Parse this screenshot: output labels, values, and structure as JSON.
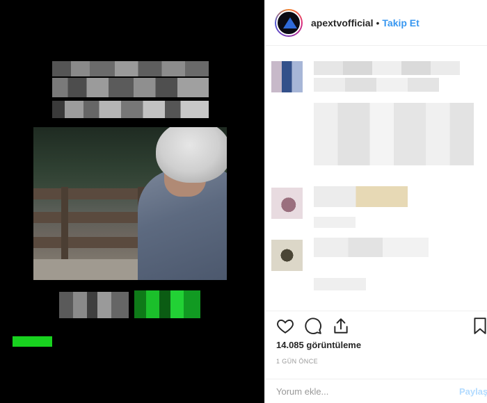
{
  "header": {
    "username": "apextvofficial",
    "separator": "•",
    "follow_label": "Takip Et"
  },
  "media": {
    "accent_green": "#18d21f"
  },
  "actions": {
    "like_icon": "heart-icon",
    "comment_icon": "comment-icon",
    "share_icon": "share-icon",
    "save_icon": "bookmark-icon"
  },
  "stats": {
    "views": "14.085 görüntüleme",
    "time_ago": "1 GÜN ÖNCE"
  },
  "comment_box": {
    "placeholder": "Yorum ekle...",
    "post_label": "Paylaş"
  },
  "colors": {
    "link_blue": "#3897f0",
    "post_disabled": "#b3dbff",
    "border": "#efefef"
  }
}
